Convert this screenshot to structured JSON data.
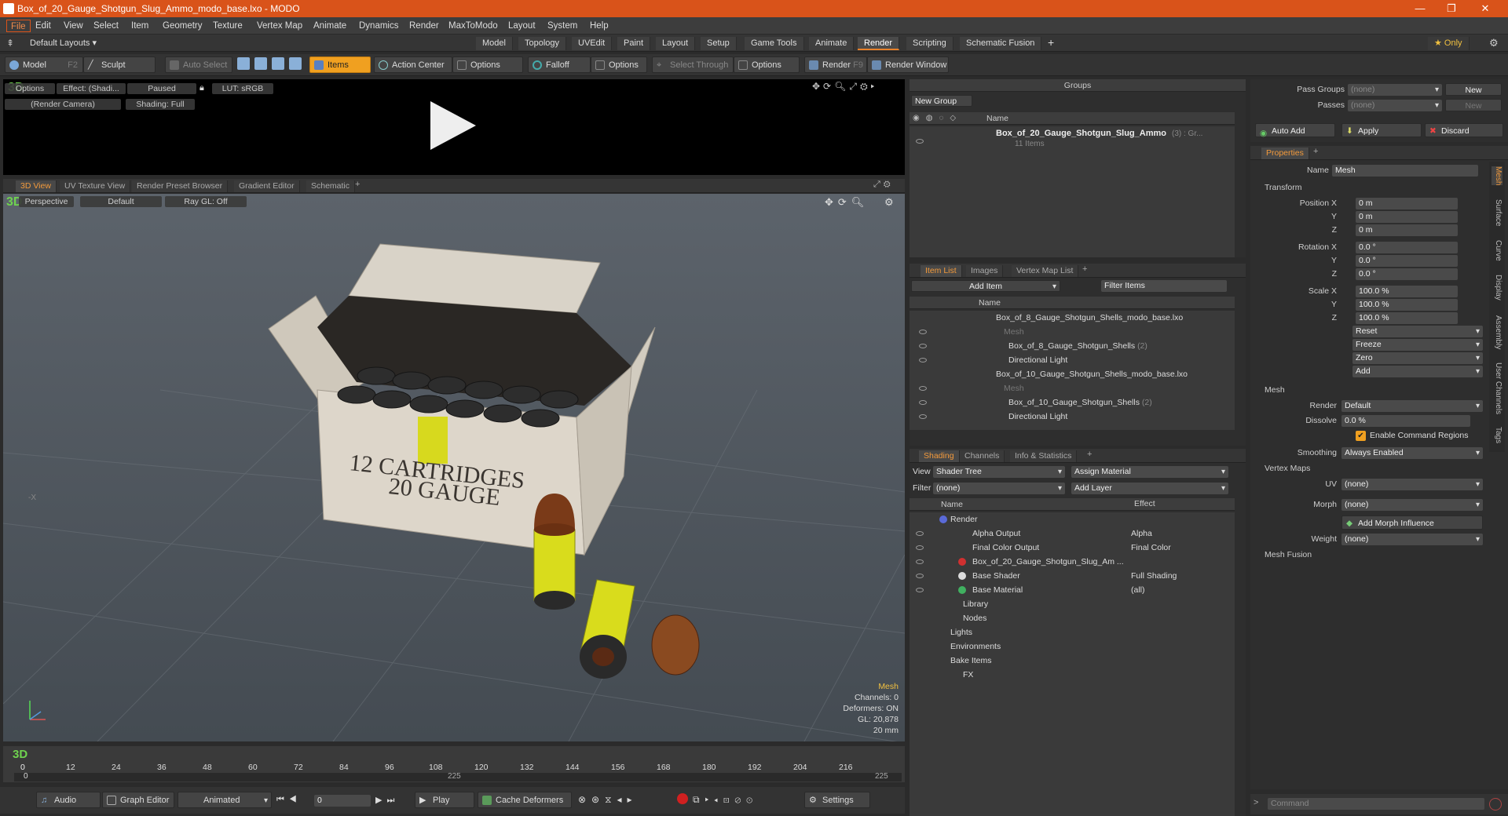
{
  "window": {
    "title": "Box_of_20_Gauge_Shotgun_Slug_Ammo_modo_base.lxo - MODO",
    "min": "—",
    "max": "❐",
    "close": "✕"
  },
  "menu": [
    "File",
    "Edit",
    "View",
    "Select",
    "Item",
    "Geometry",
    "Texture",
    "Vertex Map",
    "Animate",
    "Dynamics",
    "Render",
    "MaxToModo",
    "Layout",
    "System",
    "Help"
  ],
  "layouts": {
    "dropdown": "Default Layouts ▾",
    "tabs": [
      "Model",
      "Topology",
      "UVEdit",
      "Paint",
      "Layout",
      "Setup",
      "Game Tools",
      "Animate",
      "Render",
      "Scripting",
      "Schematic Fusion"
    ],
    "active": "Render",
    "plus": "+",
    "only": "★  Only"
  },
  "toolbar": {
    "model": "Model",
    "model_key": "F2",
    "sculpt": "Sculpt",
    "auto_select": "Auto Select",
    "items": "Items",
    "action_center": "Action Center",
    "options1": "Options",
    "falloff": "Falloff",
    "options2": "Options",
    "select_through": "Select Through",
    "options3": "Options",
    "render": "Render",
    "render_key": "F9",
    "render_window": "Render Window"
  },
  "preview": {
    "options": "Options",
    "effect": "Effect: (Shadi...",
    "paused": "Paused",
    "lut": "LUT: sRGB",
    "camera": "(Render Camera)",
    "shading": "Shading: Full"
  },
  "view_tabs": [
    "3D View",
    "UV Texture View",
    "Render Preset Browser",
    "Gradient Editor",
    "Schematic",
    "+"
  ],
  "viewport": {
    "perspective": "Perspective",
    "default": "Default",
    "raygl": "Ray GL: Off",
    "axis_x": "-X",
    "box_text1": "12 CARTRIDGES",
    "box_text2": "20 GAUGE",
    "stats": [
      "Mesh",
      "Channels: 0",
      "Deformers: ON",
      "GL: 20,878",
      "20 mm"
    ]
  },
  "timeline": {
    "ticks": [
      "0",
      "12",
      "24",
      "36",
      "48",
      "60",
      "72",
      "84",
      "96",
      "108",
      "120",
      "132",
      "144",
      "156",
      "168",
      "180",
      "192",
      "204",
      "216"
    ],
    "mid": "225",
    "end": "225"
  },
  "bottom": {
    "audio": "Audio",
    "graph_editor": "Graph Editor",
    "animated": "Animated",
    "frame": "0",
    "play": "Play",
    "cache": "Cache Deformers",
    "settings": "Settings"
  },
  "groups": {
    "title": "Groups",
    "new_group": "New Group",
    "name_col": "Name",
    "item_name": "Box_of_20_Gauge_Shotgun_Slug_Ammo",
    "item_count": "(3) : Gr...",
    "sub": "11 Items"
  },
  "itemlist": {
    "tabs": [
      "Item List",
      "Images",
      "Vertex Map List",
      "+"
    ],
    "add_item": "Add Item",
    "filter": "Filter Items",
    "name_col": "Name",
    "rows": [
      {
        "t": "Box_of_8_Gauge_Shotgun_Shells_modo_base.lxo",
        "i": 0
      },
      {
        "t": "Mesh",
        "i": 2,
        "dim": true
      },
      {
        "t": "Box_of_8_Gauge_Shotgun_Shells",
        "n": "(2)",
        "i": 2
      },
      {
        "t": "Directional Light",
        "i": 2
      },
      {
        "t": "Box_of_10_Gauge_Shotgun_Shells_modo_base.lxo",
        "i": 0
      },
      {
        "t": "Mesh",
        "i": 2,
        "dim": true
      },
      {
        "t": "Box_of_10_Gauge_Shotgun_Shells",
        "n": "(2)",
        "i": 2
      },
      {
        "t": "Directional Light",
        "i": 2
      }
    ]
  },
  "shading": {
    "tabs": [
      "Shading",
      "Channels",
      "Info & Statistics",
      "+"
    ],
    "view_label": "View",
    "view": "Shader Tree",
    "assign": "Assign Material",
    "filter_label": "Filter",
    "filter": "(none)",
    "add_layer": "Add Layer",
    "name_col": "Name",
    "effect_col": "Effect",
    "rows": [
      {
        "t": "Render",
        "e": "",
        "i": 0
      },
      {
        "t": "Alpha Output",
        "e": "Alpha",
        "i": 1
      },
      {
        "t": "Final Color Output",
        "e": "Final Color",
        "i": 1
      },
      {
        "t": "Box_of_20_Gauge_Shotgun_Slug_Am ...",
        "e": "",
        "i": 1
      },
      {
        "t": "Base Shader",
        "e": "Full Shading",
        "i": 1
      },
      {
        "t": "Base Material",
        "e": "(all)",
        "i": 1
      },
      {
        "t": "Library",
        "e": "",
        "i": 1
      },
      {
        "t": "Nodes",
        "e": "",
        "i": 1
      },
      {
        "t": "Lights",
        "e": "",
        "i": 0
      },
      {
        "t": "Environments",
        "e": "",
        "i": 0
      },
      {
        "t": "Bake Items",
        "e": "",
        "i": 0
      },
      {
        "t": "FX",
        "e": "",
        "i": 0
      }
    ]
  },
  "passes": {
    "pass_groups": "Pass Groups",
    "passes": "Passes",
    "none": "(none)",
    "new": "New",
    "auto_add": "Auto Add",
    "apply": "Apply",
    "discard": "Discard"
  },
  "properties": {
    "tab": "Properties",
    "plus": "+",
    "name_label": "Name",
    "name": "Mesh",
    "transform": "Transform",
    "pos_x": "Position X",
    "y": "Y",
    "z": "Z",
    "rot_x": "Rotation X",
    "scale_x": "Scale X",
    "p": [
      "0 m",
      "0 m",
      "0 m"
    ],
    "r": [
      "0.0 °",
      "0.0 °",
      "0.0 °"
    ],
    "s": [
      "100.0 %",
      "100.0 %",
      "100.0 %"
    ],
    "reset": "Reset",
    "freeze": "Freeze",
    "zero": "Zero",
    "add": "Add",
    "mesh": "Mesh",
    "render_label": "Render",
    "render": "Default",
    "dissolve_label": "Dissolve",
    "dissolve": "0.0 %",
    "cmd_regions": "Enable Command Regions",
    "smoothing_label": "Smoothing",
    "smoothing": "Always Enabled",
    "vmaps": "Vertex Maps",
    "uv_label": "UV",
    "uv": "(none)",
    "morph_label": "Morph",
    "morph": "(none)",
    "add_morph": "Add Morph Influence",
    "weight_label": "Weight",
    "weight": "(none)",
    "mesh_fusion": "Mesh Fusion",
    "side_tabs": [
      "Mesh",
      "Surface",
      "Curve",
      "Display",
      "Assembly",
      "User Channels",
      "Tags"
    ],
    "command": "Command"
  }
}
